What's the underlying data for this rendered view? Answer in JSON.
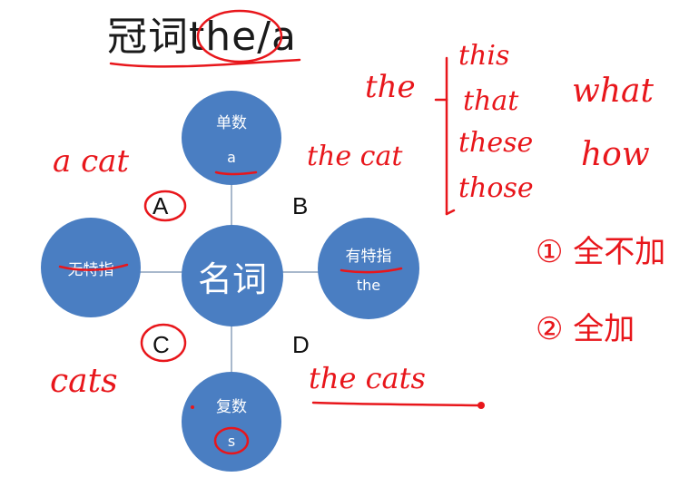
{
  "title": "冠词the/a",
  "diagram": {
    "center": "名词",
    "top": {
      "label": "单数",
      "sub": "a"
    },
    "left": {
      "label": "无特指"
    },
    "right": {
      "label": "有特指",
      "sub": "the"
    },
    "bottom": {
      "label": "复数",
      "sub": "s"
    },
    "quadrants": {
      "a": "A",
      "b": "B",
      "c": "C",
      "d": "D"
    }
  },
  "annotations": {
    "a_cat": "a cat",
    "the_cat": "the cat",
    "cats": "cats",
    "the_cats": "the cats",
    "the": "the",
    "determiners": [
      "this",
      "that",
      "these",
      "those"
    ],
    "what": "what",
    "how": "how",
    "rule1": "① 全不加",
    "rule2": "② 全加"
  },
  "colors": {
    "node": "#4a7ec2",
    "ink": "#e8161b",
    "connector": "#a8b8cc"
  }
}
